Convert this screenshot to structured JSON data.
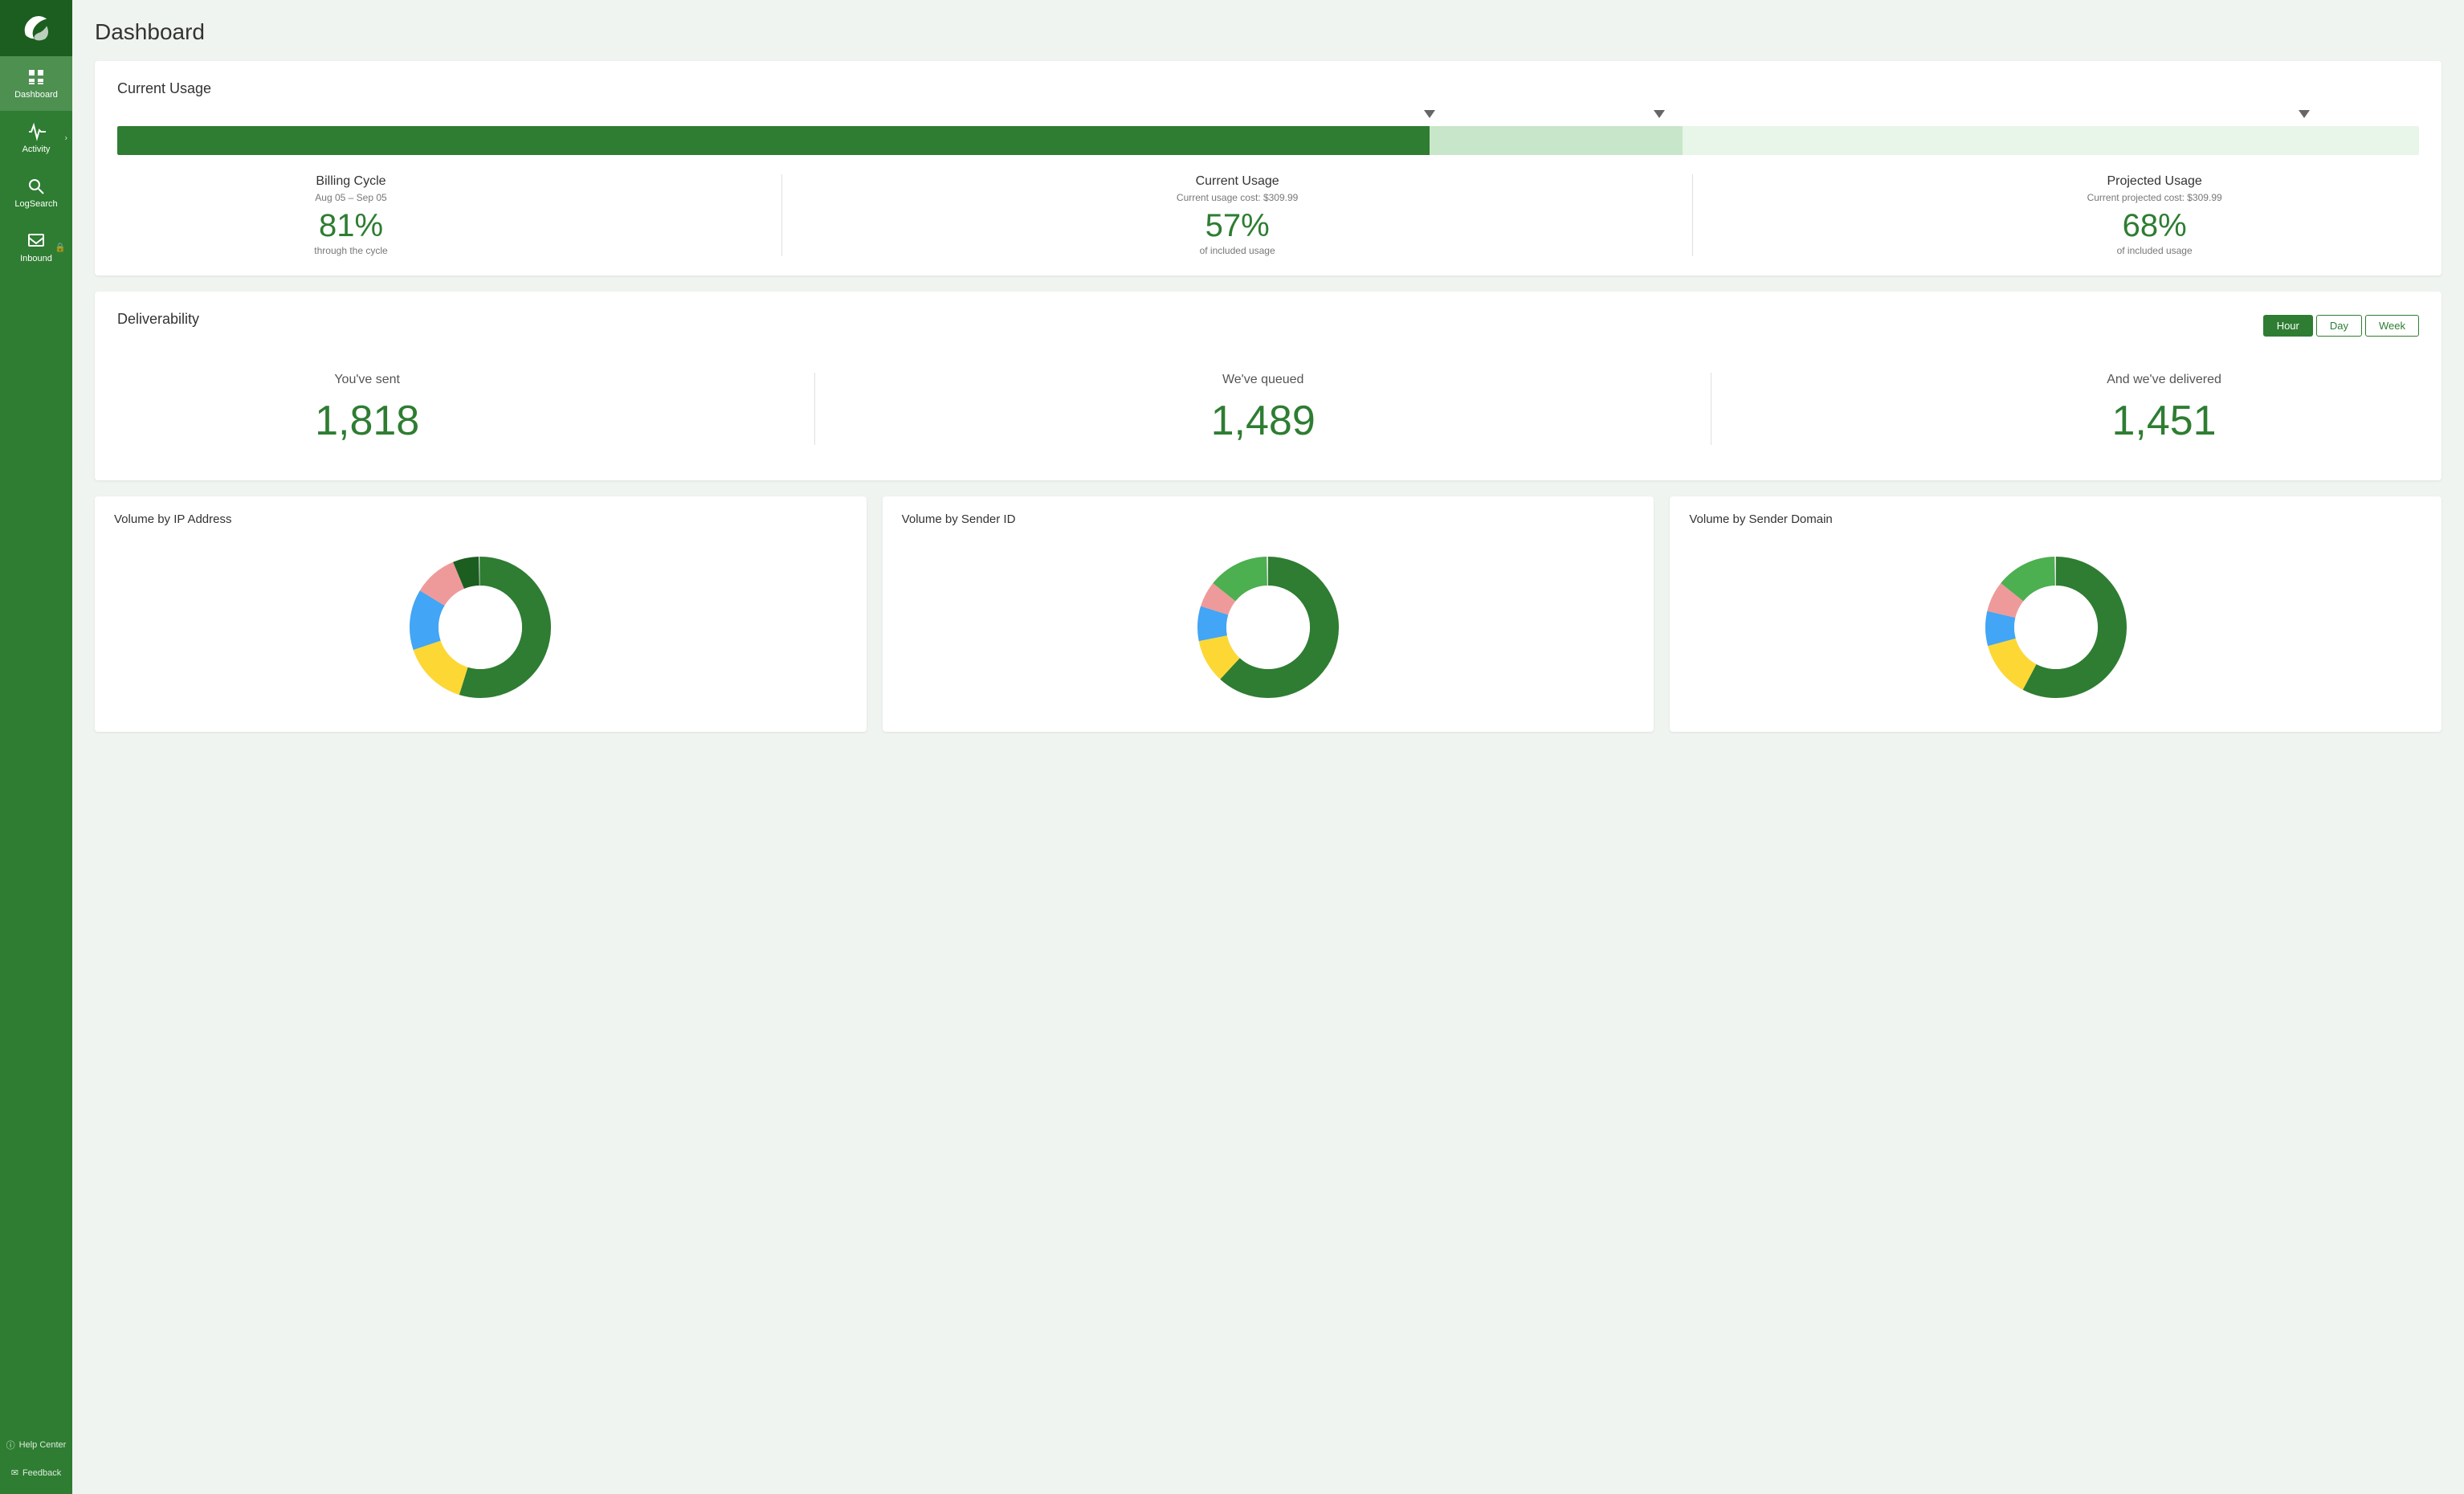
{
  "sidebar": {
    "logo_alt": "Sparrow logo",
    "items": [
      {
        "id": "dashboard",
        "label": "Dashboard",
        "icon": "dashboard-icon",
        "active": true
      },
      {
        "id": "activity",
        "label": "Activity",
        "icon": "activity-icon",
        "has_chevron": true
      },
      {
        "id": "logsearch",
        "label": "LogSearch",
        "icon": "logsearch-icon"
      },
      {
        "id": "inbound",
        "label": "Inbound",
        "icon": "inbound-icon",
        "has_lock": true
      }
    ],
    "bottom": [
      {
        "id": "help",
        "label": "Help Center",
        "icon": "help-icon"
      },
      {
        "id": "feedback",
        "label": "Feedback",
        "icon": "feedback-icon"
      }
    ]
  },
  "page": {
    "title": "Dashboard"
  },
  "current_usage": {
    "title": "Current Usage",
    "bar": {
      "green_pct": 57,
      "light_pct": 11,
      "marker1_pct": 57,
      "marker2_pct": 67,
      "marker3_pct": 95
    },
    "billing": {
      "label": "Billing Cycle",
      "dates": "Aug 05 – Sep 05",
      "value": "81%",
      "desc": "through the cycle"
    },
    "current": {
      "label": "Current Usage",
      "sub": "Current usage cost: $309.99",
      "value": "57%",
      "desc": "of included usage"
    },
    "projected": {
      "label": "Projected Usage",
      "sub": "Current projected cost: $309.99",
      "value": "68%",
      "desc": "of included usage"
    }
  },
  "deliverability": {
    "title": "Deliverability",
    "time_buttons": [
      "Hour",
      "Day",
      "Week"
    ],
    "active_time": "Hour",
    "sent": {
      "label": "You've sent",
      "value": "1,818"
    },
    "queued": {
      "label": "We've queued",
      "value": "1,489"
    },
    "delivered": {
      "label": "And we've delivered",
      "value": "1,451"
    }
  },
  "volume_cards": [
    {
      "title": "Volume by IP Address",
      "donut": {
        "segments": [
          {
            "color": "#2e7d32",
            "pct": 55
          },
          {
            "color": "#fdd835",
            "pct": 15
          },
          {
            "color": "#42a5f5",
            "pct": 14
          },
          {
            "color": "#ef9a9a",
            "pct": 10
          },
          {
            "color": "#2e7d32",
            "pct": 6
          }
        ]
      }
    },
    {
      "title": "Volume by Sender ID",
      "donut": {
        "segments": [
          {
            "color": "#2e7d32",
            "pct": 62
          },
          {
            "color": "#fdd835",
            "pct": 10
          },
          {
            "color": "#42a5f5",
            "pct": 8
          },
          {
            "color": "#ef9a9a",
            "pct": 6
          },
          {
            "color": "#2e7d32",
            "pct": 14
          }
        ]
      }
    },
    {
      "title": "Volume by Sender Domain",
      "donut": {
        "segments": [
          {
            "color": "#2e7d32",
            "pct": 58
          },
          {
            "color": "#fdd835",
            "pct": 13
          },
          {
            "color": "#42a5f5",
            "pct": 8
          },
          {
            "color": "#ef9a9a",
            "pct": 7
          },
          {
            "color": "#2e7d32",
            "pct": 14
          }
        ]
      }
    }
  ]
}
